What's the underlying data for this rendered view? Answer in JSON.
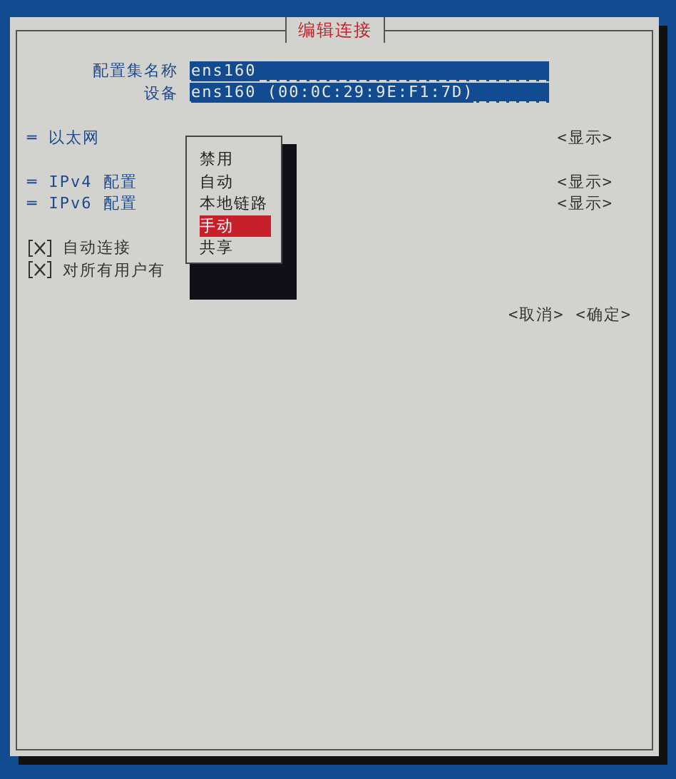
{
  "dialog": {
    "title": "编辑连接"
  },
  "fields": [
    {
      "label": "配置集名称",
      "value": "ens160"
    },
    {
      "label": "设备",
      "value": "ens160 (00:0C:29:9E:F1:7D)"
    }
  ],
  "sections": [
    {
      "marker": "═",
      "label": "以太网",
      "button": "<显示>"
    },
    {
      "marker": "═",
      "label": "IPv4 配置",
      "button": "<显示>"
    },
    {
      "marker": "═",
      "label": "IPv6 配置",
      "button": "<显示>"
    }
  ],
  "checkboxes": [
    {
      "checked": true,
      "label": "自动连接"
    },
    {
      "checked": true,
      "label": "对所有用户有"
    }
  ],
  "menu": {
    "items": [
      {
        "label": "禁用",
        "selected": false
      },
      {
        "label": "自动",
        "selected": false
      },
      {
        "label": "本地链路",
        "selected": false
      },
      {
        "label": "手动",
        "selected": true
      },
      {
        "label": "共享",
        "selected": false
      }
    ]
  },
  "buttons": [
    "<取消>",
    "<确定>"
  ]
}
